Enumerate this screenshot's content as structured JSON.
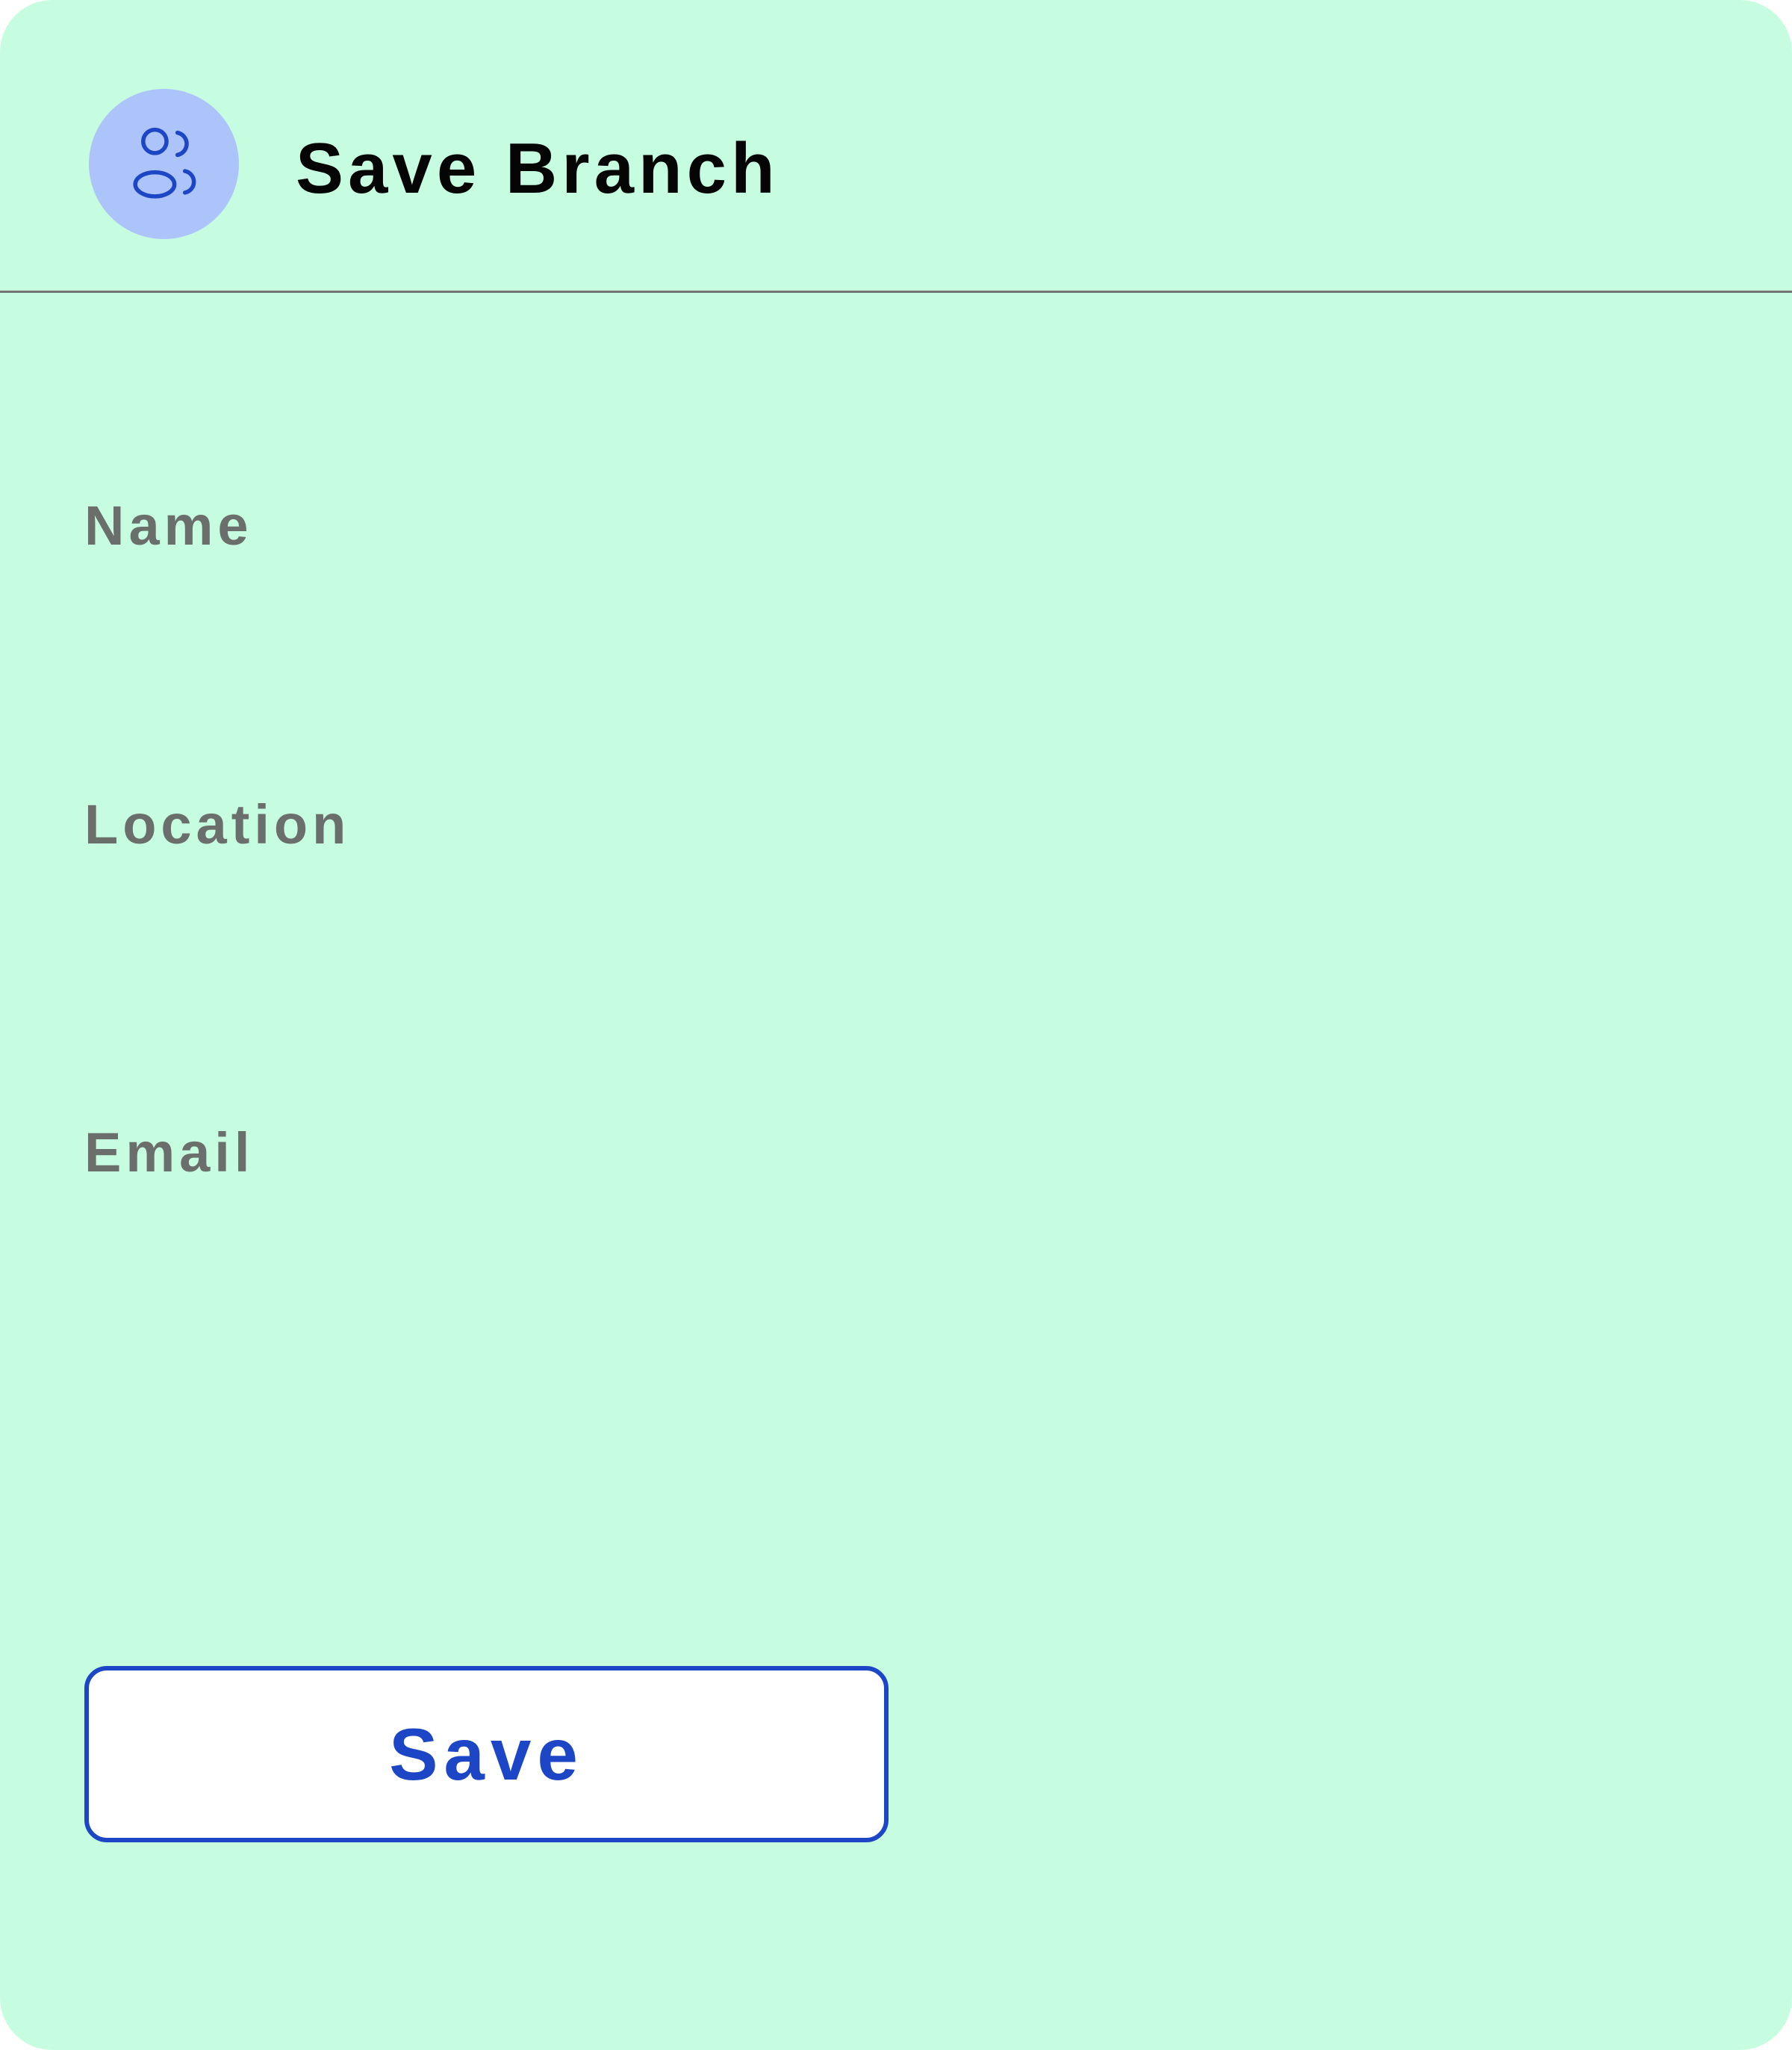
{
  "colors": {
    "card_background": "#c6fcdf",
    "avatar_background": "#adc4fb",
    "accent": "#1d46c7",
    "label_text": "#6b6f6c",
    "divider": "#737373"
  },
  "header": {
    "icon": "users-icon",
    "title": "Save Branch"
  },
  "form": {
    "fields": [
      {
        "label": "Name",
        "value": "",
        "placeholder": ""
      },
      {
        "label": "Location",
        "value": "",
        "placeholder": ""
      },
      {
        "label": "Email",
        "value": "",
        "placeholder": ""
      }
    ],
    "save_label": "Save"
  }
}
